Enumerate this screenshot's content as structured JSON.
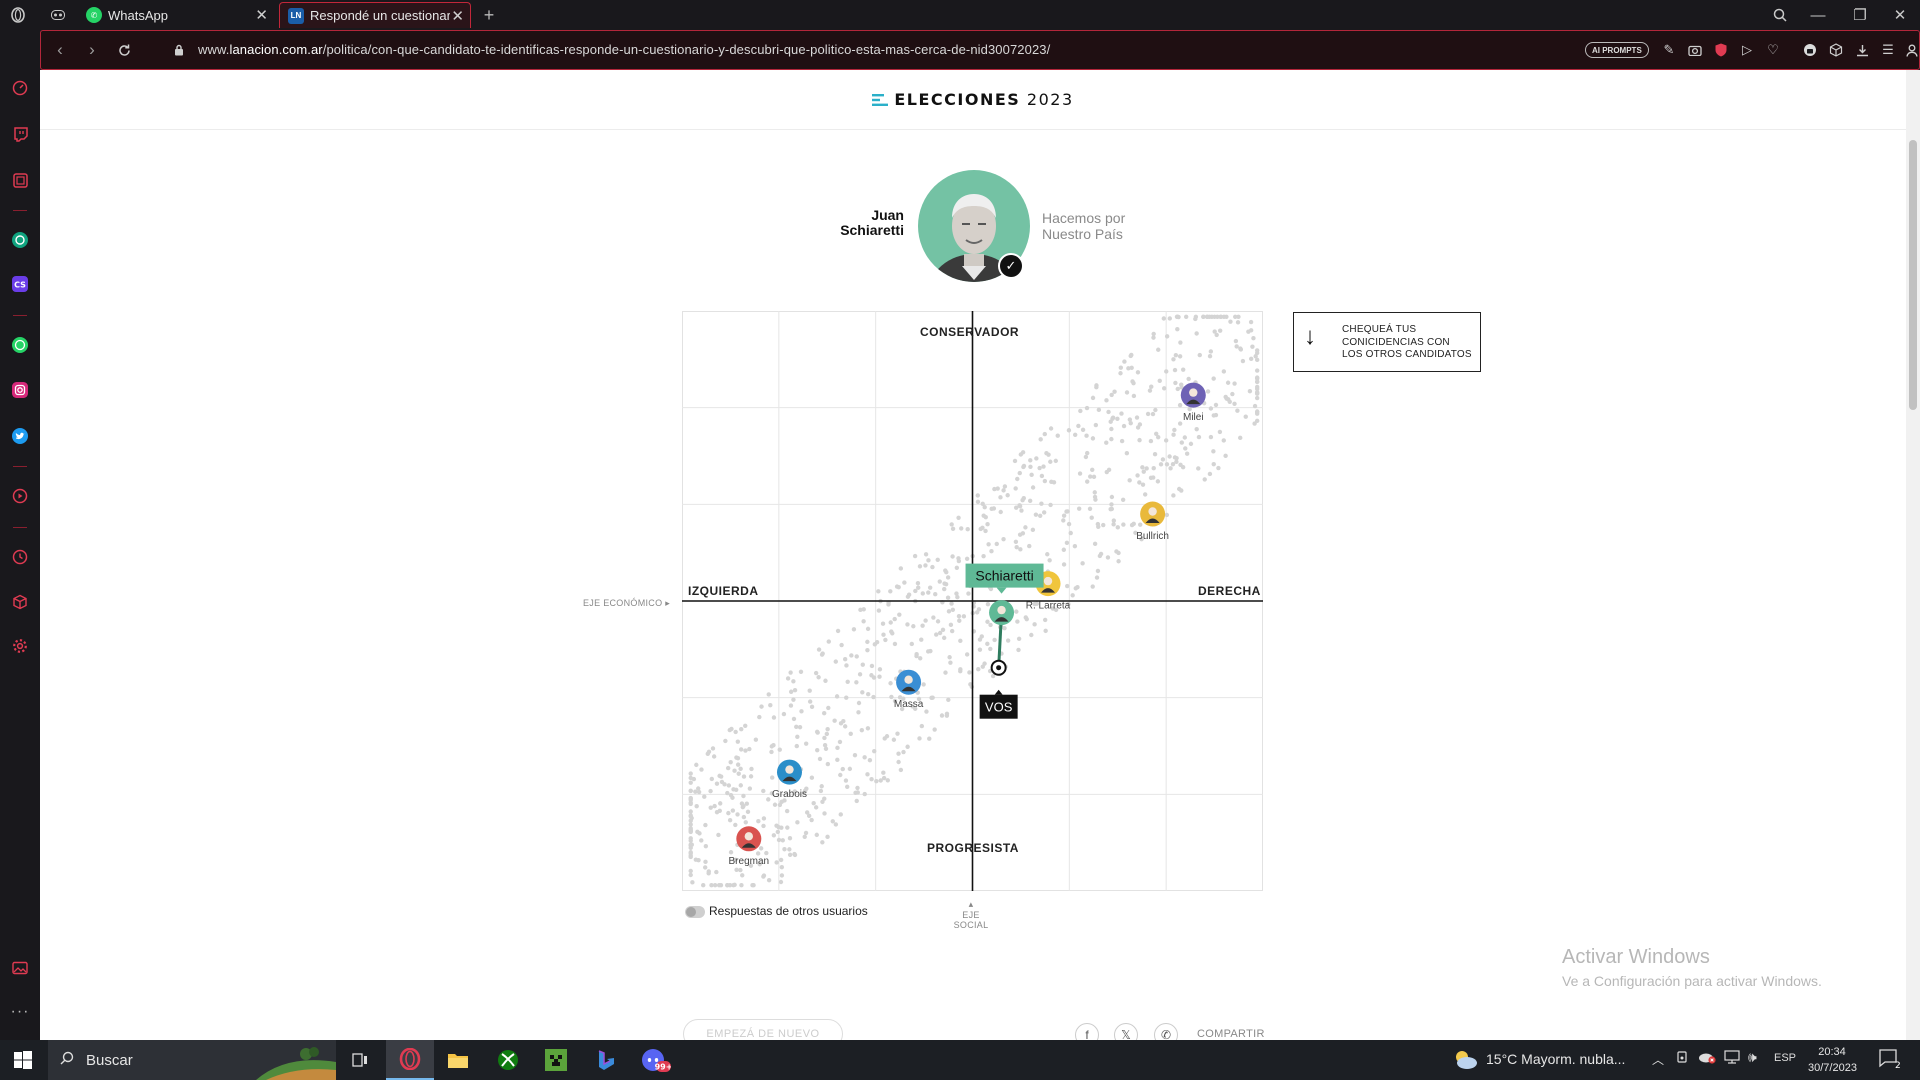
{
  "browser": {
    "tabs": [
      {
        "title": "WhatsApp",
        "active": false
      },
      {
        "title": "Respondé un cuestionario",
        "active": true
      }
    ],
    "new_tab_symbol": "+",
    "url_prefix": "www.",
    "url_domain": "lanacion.com.ar",
    "url_path": "/politica/con-que-candidato-te-identificas-responde-un-cuestionario-y-descubri-que-politico-esta-mas-cerca-de-nid30072023/",
    "ai_prompts_label": "AI PROMPTS"
  },
  "header": {
    "title_bold": "ELECCIONES",
    "title_year": "2023"
  },
  "candidate": {
    "first_name": "Juan",
    "last_name": "Schiaretti",
    "party_line1": "Hacemos por",
    "party_line2": "Nuestro País"
  },
  "chart_data": {
    "type": "scatter",
    "x_axis": {
      "left_label": "IZQUIERDA",
      "right_label": "DERECHA",
      "name": "EJE ECONÓMICO"
    },
    "y_axis": {
      "top_label": "CONSERVADOR",
      "bottom_label": "PROGRESISTA",
      "name": "EJE SOCIAL"
    },
    "xlim": [
      -1,
      1
    ],
    "ylim": [
      -1,
      1
    ],
    "grid_divisions": 6,
    "grid": true,
    "candidates": [
      {
        "name": "Milei",
        "x": 0.76,
        "y": 0.71,
        "color": "#6e62b5"
      },
      {
        "name": "Bullrich",
        "x": 0.62,
        "y": 0.3,
        "color": "#e9b93b"
      },
      {
        "name": "R. Larreta",
        "x": 0.26,
        "y": 0.06,
        "color": "#f0c53c"
      },
      {
        "name": "Schiaretti",
        "x": 0.1,
        "y": -0.04,
        "color": "#5fb996"
      },
      {
        "name": "Massa",
        "x": -0.22,
        "y": -0.28,
        "color": "#3a8ed4"
      },
      {
        "name": "Grabois",
        "x": -0.63,
        "y": -0.59,
        "color": "#2a8ec9"
      },
      {
        "name": "Bregman",
        "x": -0.77,
        "y": -0.82,
        "color": "#d9534f"
      }
    ],
    "highlight": {
      "name": "Schiaretti",
      "color": "#5fb996"
    },
    "user_point": {
      "label": "VOS",
      "x": 0.09,
      "y": -0.23
    }
  },
  "check_box": {
    "line1": "CHEQUEÁ TUS",
    "line2": "CONICIDENCIAS CON",
    "line3": "LOS OTROS CANDIDATOS"
  },
  "toggle_label": "Respuestas de otros usuarios",
  "restart_label": "EMPEZÁ DE NUEVO",
  "share_label": "COMPARTIR",
  "watermark": {
    "title": "Activar Windows",
    "subtitle": "Ve a Configuración para activar Windows."
  },
  "taskbar": {
    "search_placeholder": "Buscar",
    "weather": "15°C  Mayorm. nubla...",
    "language": "ESP",
    "time": "20:34",
    "date": "30/7/2023",
    "notification_count": "2",
    "badge": "99+"
  }
}
